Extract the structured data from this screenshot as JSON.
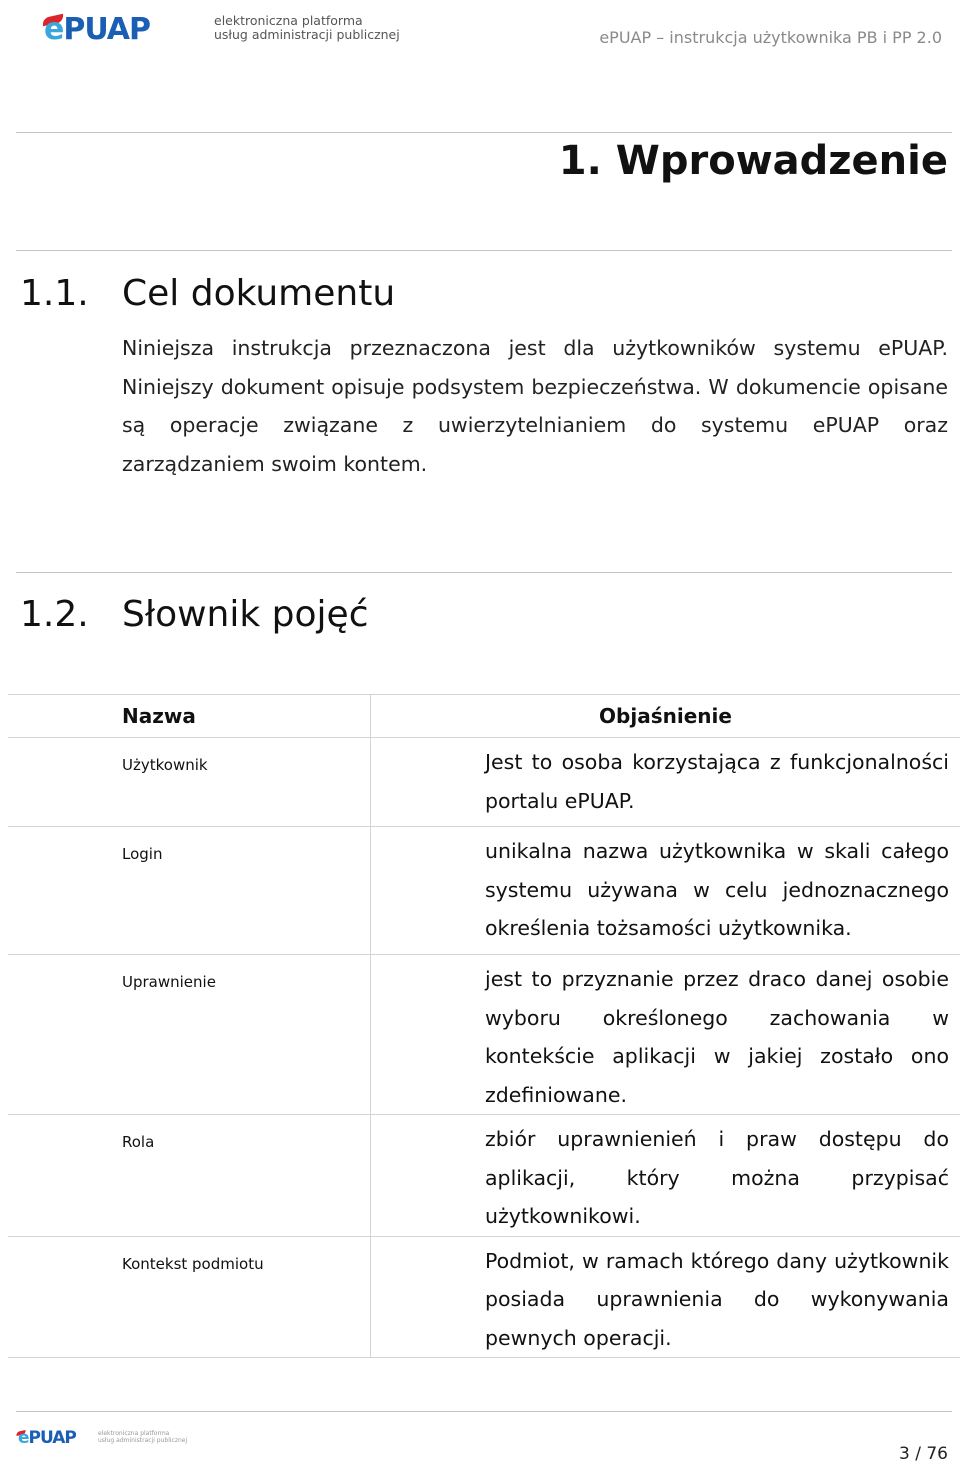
{
  "header": {
    "logo": {
      "mark": "ePUAP",
      "line1": "elektroniczna platforma",
      "line2": "usług administracji publicznej"
    },
    "running_title": "ePUAP – instrukcja użytkownika  PB i PP 2.0"
  },
  "chapter": {
    "title": "1. Wprowadzenie"
  },
  "sections": [
    {
      "number": "1.1.",
      "title": "Cel dokumentu",
      "paragraph": "Niniejsza instrukcja przeznaczona jest dla użytkowników systemu ePUAP. Niniejszy dokument opisuje podsystem bezpieczeństwa. W dokumencie opisane są operacje związane z uwierzytelnianiem do systemu ePUAP oraz zarządzaniem swoim kontem."
    },
    {
      "number": "1.2.",
      "title": "Słownik pojęć"
    }
  ],
  "glossary": {
    "headers": {
      "name": "Nazwa",
      "explanation": "Objaśnienie"
    },
    "rows": [
      {
        "term": "Użytkownik",
        "definition": "Jest to osoba korzystająca z funkcjonalności portalu ePUAP."
      },
      {
        "term": "Login",
        "definition": "unikalna nazwa użytkownika w skali całego systemu używana w celu jednoznacznego określenia tożsamości użytkownika."
      },
      {
        "term": "Uprawnienie",
        "definition": "jest to przyznanie przez draco danej osobie wyboru określonego zachowania w kontekście aplikacji w jakiej zostało ono zdefiniowane."
      },
      {
        "term": "Rola",
        "definition": "zbiór uprawnienień i praw dostępu do aplikacji, który można przypisać użytkownikowi."
      },
      {
        "term": "Kontekst podmiotu",
        "definition": "Podmiot, w ramach którego dany użytkownik posiada uprawnienia do wykonywania pewnych operacji."
      }
    ]
  },
  "footer": {
    "logo": {
      "mark": "ePUAP",
      "line1": "elektroniczna platforma",
      "line2": "usług administracji publicznej"
    },
    "page_number": "3 / 76"
  }
}
